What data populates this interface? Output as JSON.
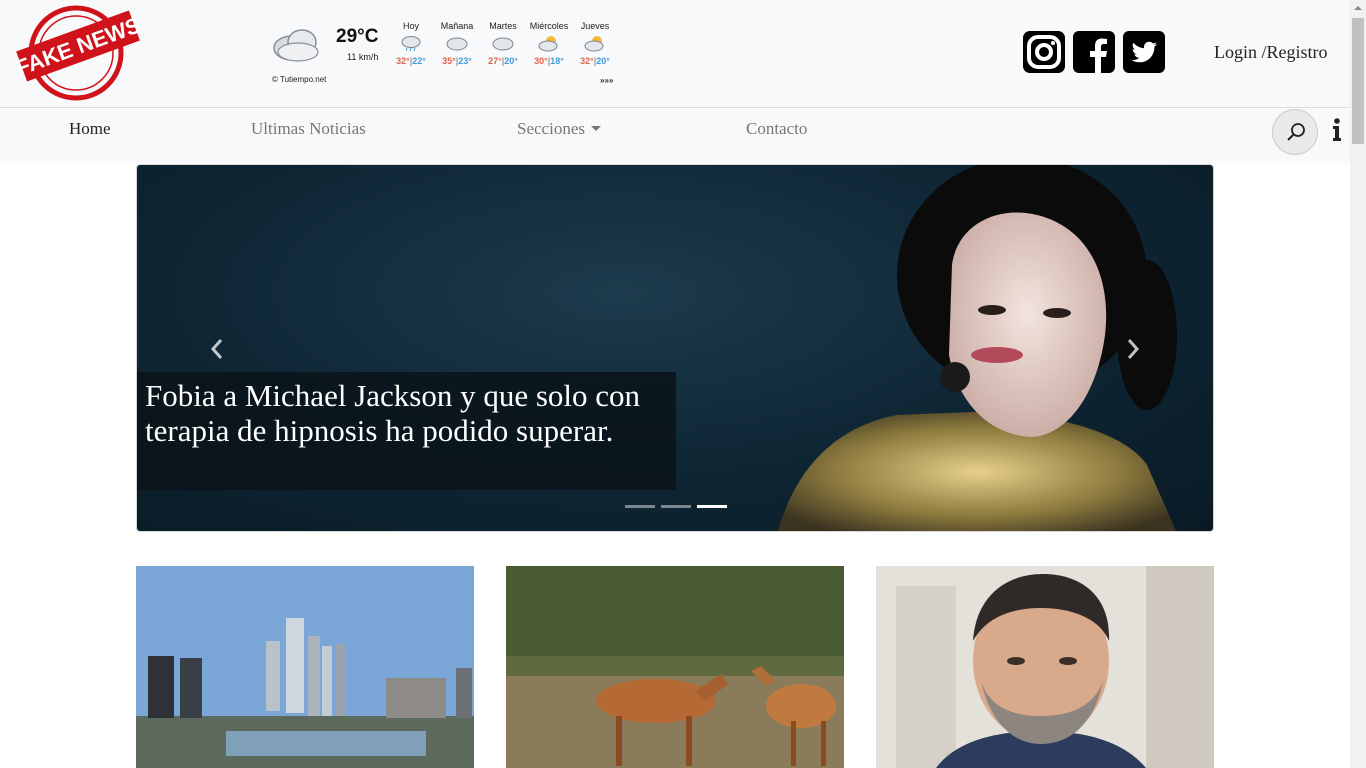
{
  "brand": {
    "logo_text": "FAKE NEWS",
    "accent": "#d0121b"
  },
  "weather": {
    "current_temp": "29°C",
    "wind": "11 km/h",
    "credit": "© Tutiempo.net",
    "more": "»»»",
    "current_icon": "partly-cloudy-icon",
    "days": [
      {
        "name": "Hoy",
        "max": "32°",
        "min": "22°",
        "icon": "rain-cloud-icon"
      },
      {
        "name": "Mañana",
        "max": "35°",
        "min": "23°",
        "icon": "cloud-icon"
      },
      {
        "name": "Martes",
        "max": "27°",
        "min": "20°",
        "icon": "cloud-icon"
      },
      {
        "name": "Miércoles",
        "max": "30°",
        "min": "18°",
        "icon": "sun-cloud-icon"
      },
      {
        "name": "Jueves",
        "max": "32°",
        "min": "20°",
        "icon": "sun-cloud-icon"
      }
    ],
    "sep": "|"
  },
  "social": [
    {
      "name": "instagram",
      "icon": "instagram-icon"
    },
    {
      "name": "facebook",
      "icon": "facebook-icon"
    },
    {
      "name": "twitter",
      "icon": "twitter-icon"
    }
  ],
  "auth": {
    "label": "Login /Registro"
  },
  "nav": {
    "home": "Home",
    "latest": "Ultimas Noticias",
    "sections": "Secciones",
    "contact": "Contacto"
  },
  "hero": {
    "title": "Fobia a Michael Jackson y que solo con terapia de hipnosis ha podido superar.",
    "slides_total": 3,
    "active_slide": 3
  },
  "cards": [
    {
      "image": "city-skyline"
    },
    {
      "image": "antelopes"
    },
    {
      "image": "bearded-man-portrait"
    }
  ],
  "colors": {
    "nav_bg": "#f8f9fa",
    "temp_max": "#e4614a",
    "temp_min": "#3f9ad9"
  }
}
